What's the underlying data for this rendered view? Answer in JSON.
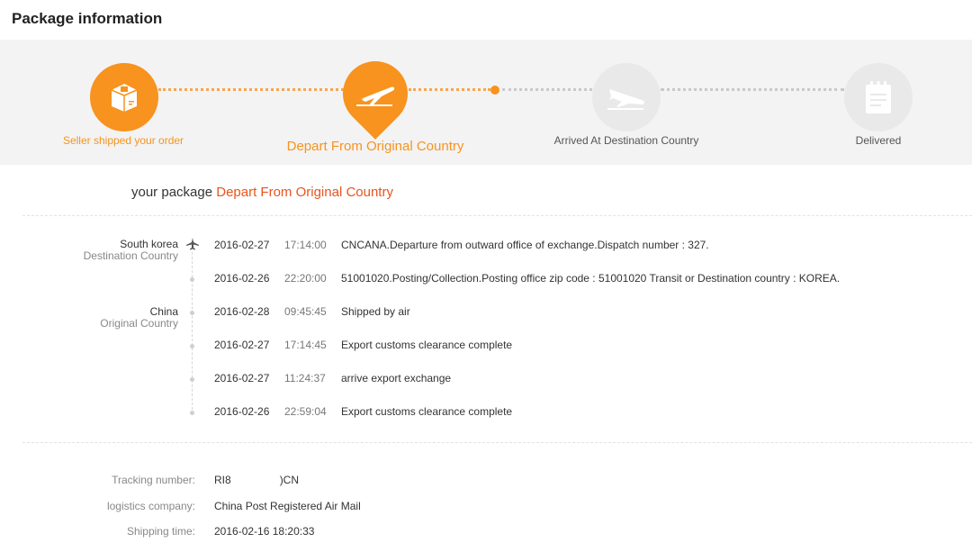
{
  "header": {
    "title": "Package information"
  },
  "progress": {
    "steps": [
      {
        "label": "Seller shipped your order",
        "icon": "package-box-icon",
        "state": "done"
      },
      {
        "label": "Depart From Original Country",
        "icon": "plane-takeoff-icon",
        "state": "current"
      },
      {
        "label": "Arrived At Destination Country",
        "icon": "plane-landing-icon",
        "state": "pending"
      },
      {
        "label": "Delivered",
        "icon": "notepad-icon",
        "state": "pending"
      }
    ],
    "accent_color": "#f7931e"
  },
  "status": {
    "prefix": "your package",
    "highlight": "Depart From Original Country"
  },
  "timeline": {
    "groups": [
      {
        "location": "South korea",
        "role": "Destination Country"
      },
      {
        "location": "China",
        "role": "Original Country"
      }
    ],
    "events": [
      {
        "date": "2016-02-27",
        "time": "17:14:00",
        "desc": "CNCANA.Departure from outward office of exchange.Dispatch number : 327."
      },
      {
        "date": "2016-02-26",
        "time": "22:20:00",
        "desc": "51001020.Posting/Collection.Posting office zip code : 51001020 Transit or Destination country : KOREA."
      },
      {
        "date": "2016-02-28",
        "time": "09:45:45",
        "desc": "Shipped by air"
      },
      {
        "date": "2016-02-27",
        "time": "17:14:45",
        "desc": "Export customs clearance complete"
      },
      {
        "date": "2016-02-27",
        "time": "11:24:37",
        "desc": "arrive export exchange"
      },
      {
        "date": "2016-02-26",
        "time": "22:59:04",
        "desc": "Export customs clearance complete"
      }
    ]
  },
  "info": {
    "tracking_label": "Tracking number:",
    "tracking_value_prefix": "RI8",
    "tracking_value_suffix": ")CN",
    "company_label": "logistics company:",
    "company_value": "China Post Registered Air Mail",
    "shipping_label": "Shipping time:",
    "shipping_value": "2016-02-16 18:20:33"
  }
}
